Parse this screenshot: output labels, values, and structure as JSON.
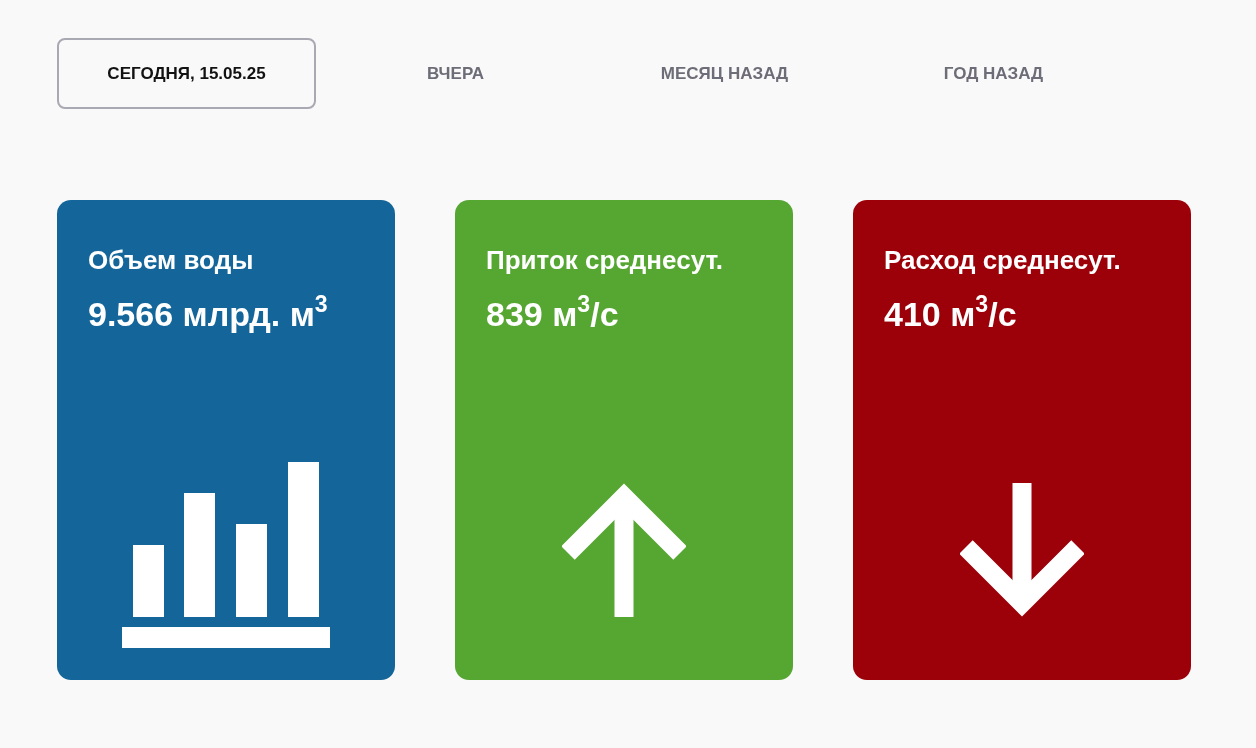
{
  "tabs": [
    {
      "label": "СЕГОДНЯ, 15.05.25",
      "selected": true
    },
    {
      "label": "ВЧЕРА",
      "selected": false
    },
    {
      "label": "МЕСЯЦ НАЗАД",
      "selected": false
    },
    {
      "label": "ГОД НАЗАД",
      "selected": false
    }
  ],
  "cards": [
    {
      "kind": "volume",
      "color": "#14669a",
      "title": "Объем воды",
      "value": "9.566 млрд. м$^{3}$"
    },
    {
      "kind": "inflow",
      "color": "#56a632",
      "title": "Приток среднесут.",
      "value": "839 м$^{3}$/с"
    },
    {
      "kind": "outflow",
      "color": "#9c0009",
      "title": "Расход среднесут.",
      "value": "410 м$^{3}$/с"
    }
  ]
}
